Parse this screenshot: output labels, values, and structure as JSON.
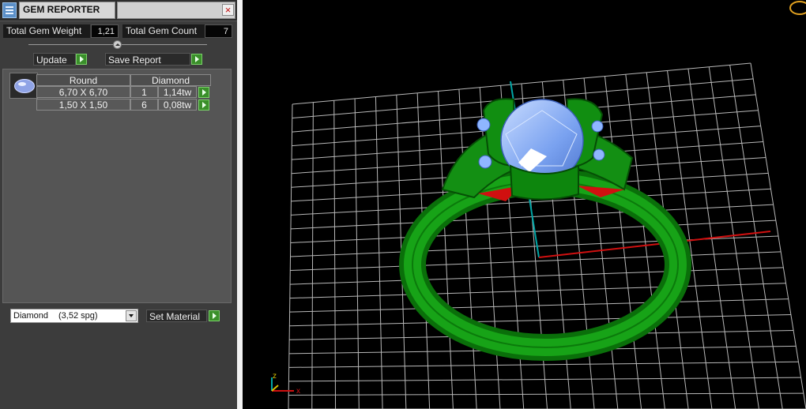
{
  "panel": {
    "title": "GEM REPORTER",
    "close_label": "×",
    "total_weight_label": "Total Gem Weight",
    "total_weight_value": "1,21",
    "total_count_label": "Total Gem Count",
    "total_count_value": "7",
    "update_label": "Update",
    "save_report_label": "Save Report",
    "table": {
      "headers": [
        "Round",
        "Diamond"
      ],
      "rows": [
        {
          "size": "6,70 X 6,70",
          "count": "1",
          "weight": "1,14tw"
        },
        {
          "size": "1,50 X 1,50",
          "count": "6",
          "weight": "0,08tw"
        }
      ]
    },
    "material_select": {
      "value": "Diamond",
      "density": "(3,52 spg)"
    },
    "set_material_label": "Set Material"
  },
  "viewport": {
    "axis_labels": {
      "z": "z",
      "x": "x"
    },
    "colors": {
      "ring": "#0f8a0f",
      "gem": "#8fb6ff",
      "grid": "#d9d9d9",
      "x_axis": "#d01010",
      "y_axis": "#00a6a6",
      "background": "#000000"
    }
  }
}
